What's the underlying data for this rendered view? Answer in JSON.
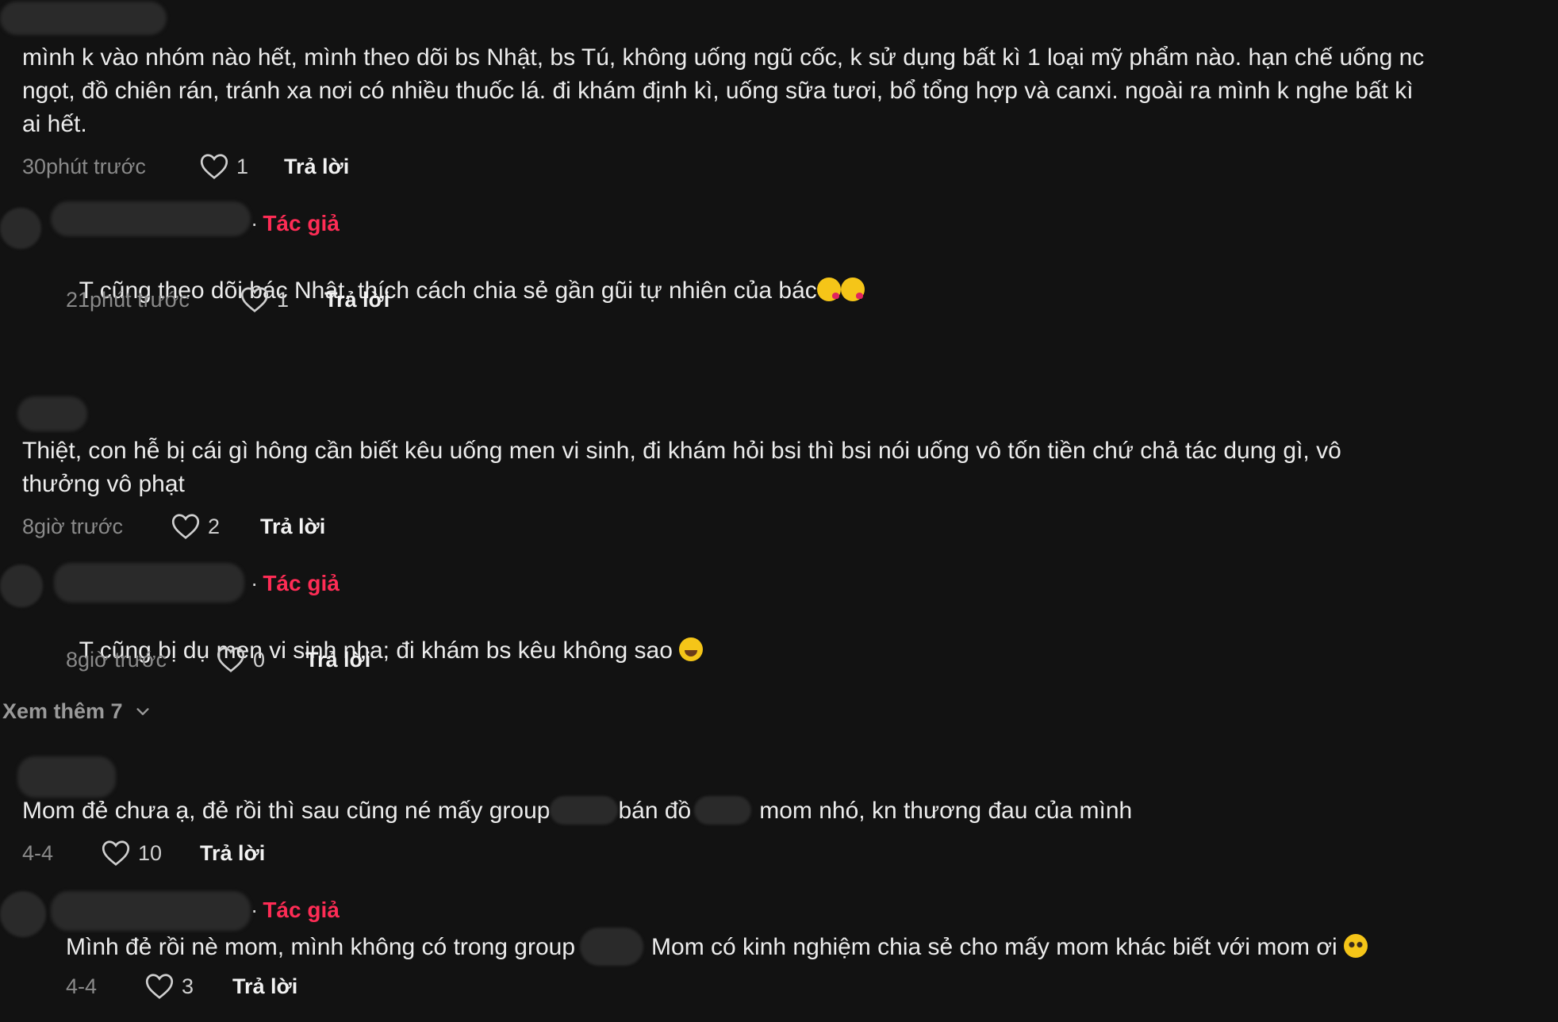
{
  "comments": [
    {
      "text": "mình k vào nhóm nào hết, mình theo dõi bs Nhật, bs Tú, không uống ngũ cốc, k sử dụng bất kì 1 loại mỹ phẩm nào. hạn chế uống nc\nngọt, đồ chiên rán, tránh xa nơi có nhiều thuốc lá. đi khám định kì, uống sữa tươi, bổ tổng hợp và canxi. ngoài ra mình k nghe bất kì\nai hết.",
      "time": "30phút trước",
      "likes": "1",
      "reply_label": "Trả lời",
      "reply": {
        "badge_dot": "·",
        "badge": "Tác giả",
        "text": "T cũng theo dõi bác Nhật, thích cách chia sẻ gần gũi tự nhiên của bác",
        "time": "21phút trước",
        "likes": "1",
        "reply_label": "Trả lời"
      }
    },
    {
      "text": "Thiệt, con hễ bị cái gì hông cần biết kêu uống men vi sinh, đi khám hỏi bsi thì bsi nói uống vô tốn tiền chứ chả tác dụng gì, vô\nthưởng vô phạt",
      "time": "8giờ trước",
      "likes": "2",
      "reply_label": "Trả lời",
      "reply": {
        "badge_dot": "·",
        "badge": "Tác giả",
        "text": "T cũng bị dụ men vi sinh nha; đi khám bs kêu không sao ",
        "time": "8giờ trước",
        "likes": "0",
        "reply_label": "Trả lời"
      },
      "see_more": "Xem thêm 7"
    },
    {
      "text_part1": "Mom đẻ chưa ạ, đẻ rồi thì sau cũng né mấy group",
      "text_part2": "bán đồ",
      "text_part3": "mom nhó, kn thương đau của mình",
      "time": "4-4",
      "likes": "10",
      "reply_label": "Trả lời",
      "reply": {
        "badge_dot": "·",
        "badge": "Tác giả",
        "text_part1": "Mình đẻ rồi nè mom, mình không có trong group",
        "text_part2": "Mom có kinh nghiệm chia sẻ cho mấy mom khác biết với mom ơi",
        "time": "4-4",
        "likes": "3",
        "reply_label": "Trả lời"
      }
    }
  ],
  "icons": {
    "like": "heart-outline-icon",
    "expand": "chevron-down-icon"
  },
  "colors": {
    "background": "#121212",
    "text": "#ececec",
    "muted": "#8a8a8a",
    "author_badge": "#fe2c55"
  }
}
